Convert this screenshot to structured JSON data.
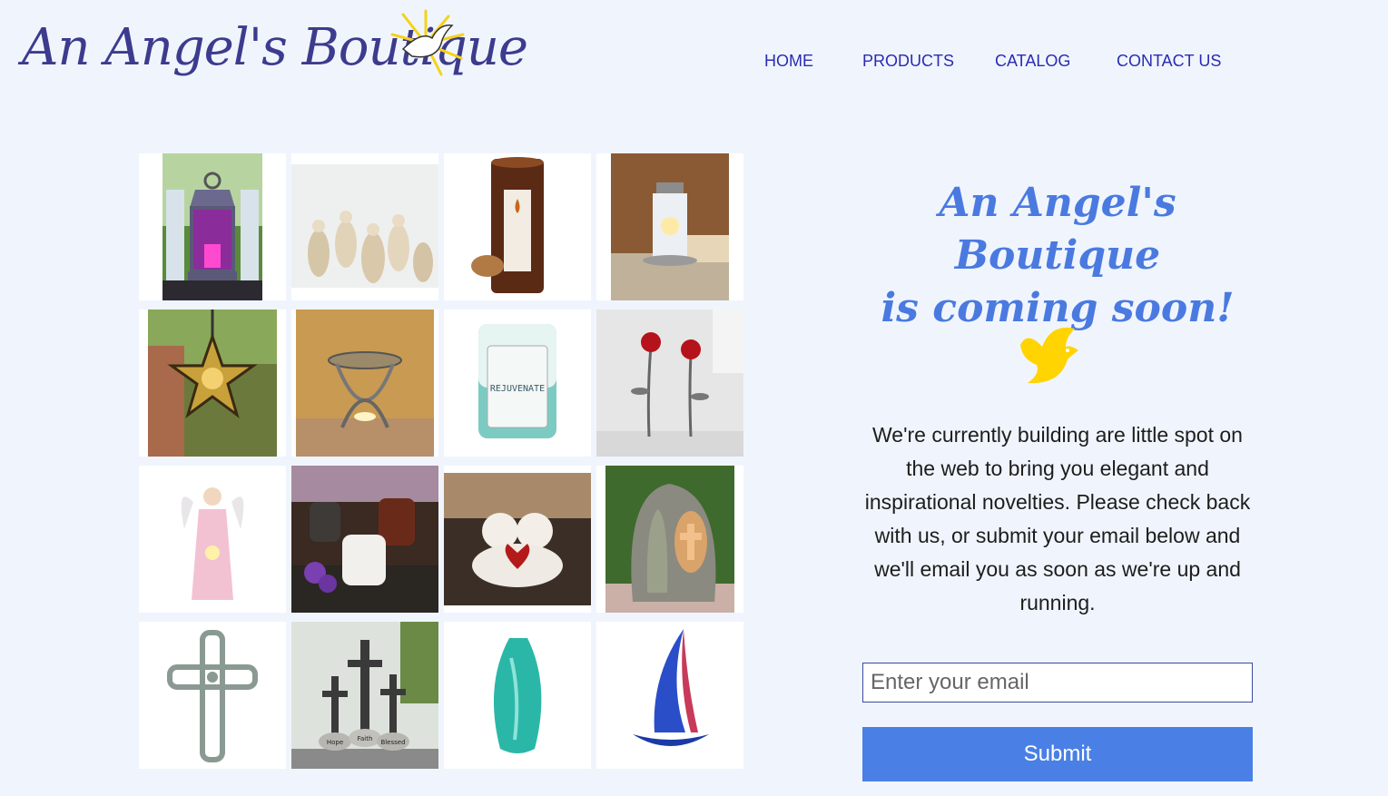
{
  "header": {
    "logo_text": "An Angel's Boutique",
    "nav": [
      "HOME",
      "PRODUCTS",
      "CATALOG",
      "CONTACT US"
    ]
  },
  "gallery": {
    "items": [
      "purple-lantern",
      "angel-figurines",
      "amber-candle",
      "lighthouse-lantern",
      "star-lantern",
      "oil-warmer",
      "rejuvenate-candle",
      "rose-candle-holder",
      "angel-figurine",
      "oil-burners",
      "cherub-figurines",
      "mary-statue",
      "ornate-cross",
      "three-crosses",
      "teal-vase",
      "glass-sailboat"
    ],
    "candle_label": "REJUVENATE",
    "crosses_stones": [
      "Hope",
      "Faith",
      "Blessed"
    ]
  },
  "coming_soon": {
    "headline_line1": "An Angel's Boutique",
    "headline_line2": "is coming soon!",
    "message": "We're currently building are little spot on the web to bring you elegant and inspirational novelties. Please check back with us, or submit your email below and we'll email you as soon as we're up and running.",
    "email_placeholder": "Enter your email",
    "submit_label": "Submit"
  },
  "colors": {
    "accent": "#4a80e5",
    "nav": "#2a2bb3",
    "bird": "#ffd400",
    "background": "#f0f5fd"
  }
}
